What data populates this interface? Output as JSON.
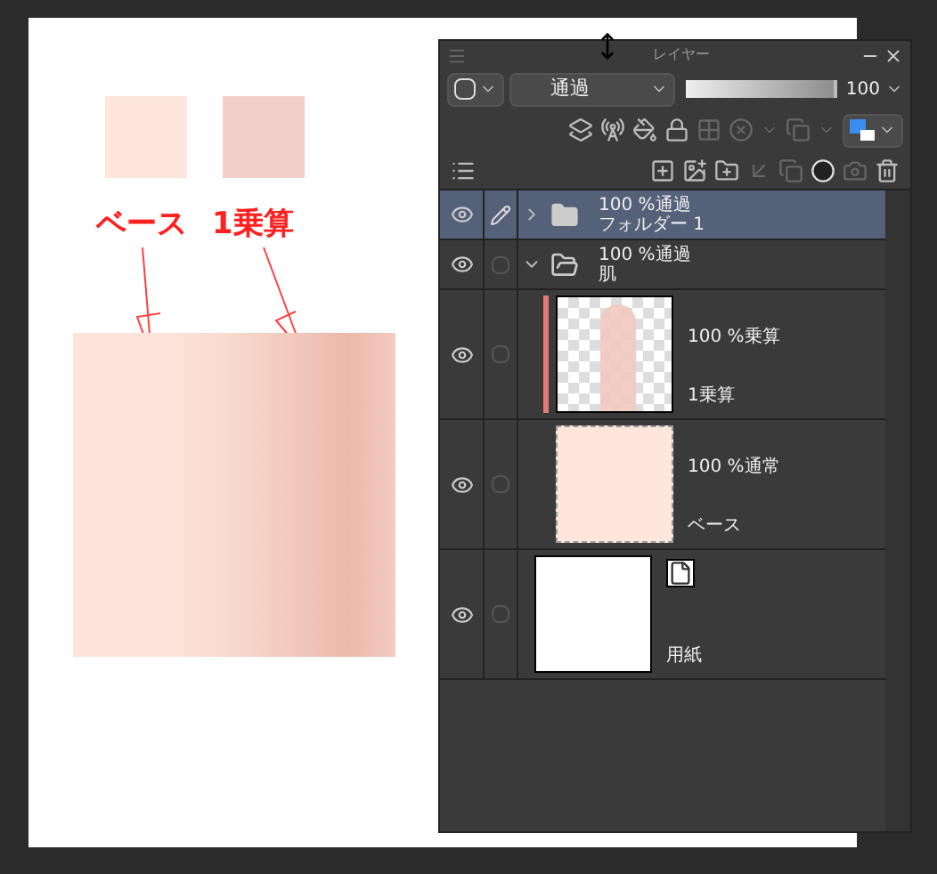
{
  "canvas": {
    "labels": [
      {
        "text": "ベース"
      },
      {
        "text": "1乗算"
      }
    ]
  },
  "layer_panel": {
    "title": "レイヤー",
    "blend_mode": "通過",
    "opacity": "100",
    "opacity_slider": {
      "level": 1
    },
    "layers": [
      {
        "kind": "folder",
        "mode": "100 %通過",
        "name": "フォルダー 1",
        "selected": true,
        "visible": true,
        "expanded": false
      },
      {
        "kind": "folder",
        "mode": "100 %通過",
        "name": "肌",
        "selected": false,
        "visible": true,
        "expanded": true,
        "children": [
          {
            "kind": "stripe",
            "mode": "100 %乗算",
            "name": "1乗算",
            "clipping": true,
            "selected": false,
            "visible": true
          },
          {
            "kind": "fill",
            "mode": "100 %通常",
            "name": "ベース",
            "clipping": false,
            "selected": false,
            "visible": true
          }
        ]
      },
      {
        "kind": "paper",
        "name": "用紙",
        "selected": false,
        "visible": true
      }
    ]
  }
}
